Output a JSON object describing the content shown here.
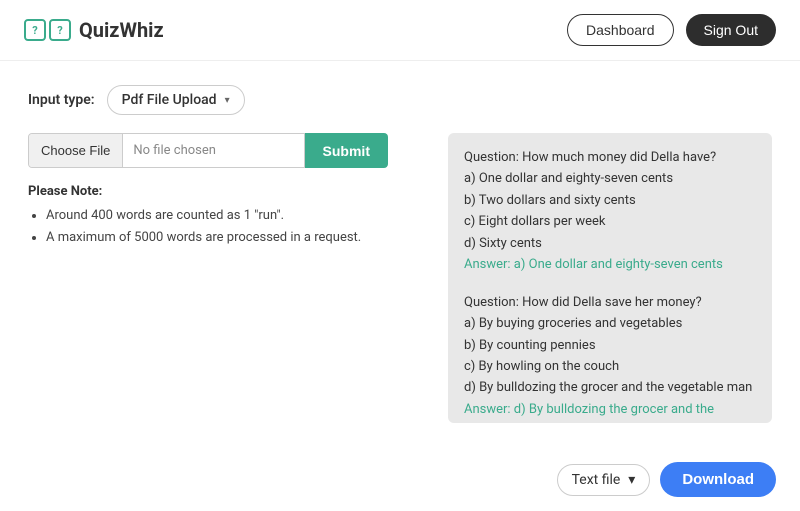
{
  "header": {
    "logo_text": "QuizWhiz",
    "logo_icon_left": "?",
    "logo_icon_right": "?",
    "dashboard_label": "Dashboard",
    "signout_label": "Sign Out"
  },
  "input_type": {
    "label": "Input type:",
    "selected_value": "Pdf File Upload"
  },
  "file_upload": {
    "choose_button_label": "Choose File",
    "file_name_placeholder": "No file chosen",
    "submit_label": "Submit"
  },
  "notes": {
    "title": "Please Note:",
    "items": [
      "Around 400 words are counted as 1 \"run\".",
      "A maximum of 5000 words are processed in a request."
    ]
  },
  "quiz_output": {
    "questions": [
      {
        "question": "Question: How much money did Della have?",
        "options": [
          "a) One dollar and eighty-seven cents",
          "b) Two dollars and sixty cents",
          "c) Eight dollars per week",
          "d) Sixty cents"
        ],
        "answer": "Answer: a) One dollar and eighty-seven cents"
      },
      {
        "question": "Question: How did Della save her money?",
        "options": [
          "a) By buying groceries and vegetables",
          "b) By counting pennies",
          "c) By howling on the couch",
          "d) By bulldozing the grocer and the vegetable man"
        ],
        "answer": "Answer: d) By bulldozing the grocer and the vegetable man"
      }
    ],
    "partial_text": "vegetable man."
  },
  "download_bar": {
    "format_label": "Text file",
    "chevron": "▾",
    "download_label": "Download"
  }
}
